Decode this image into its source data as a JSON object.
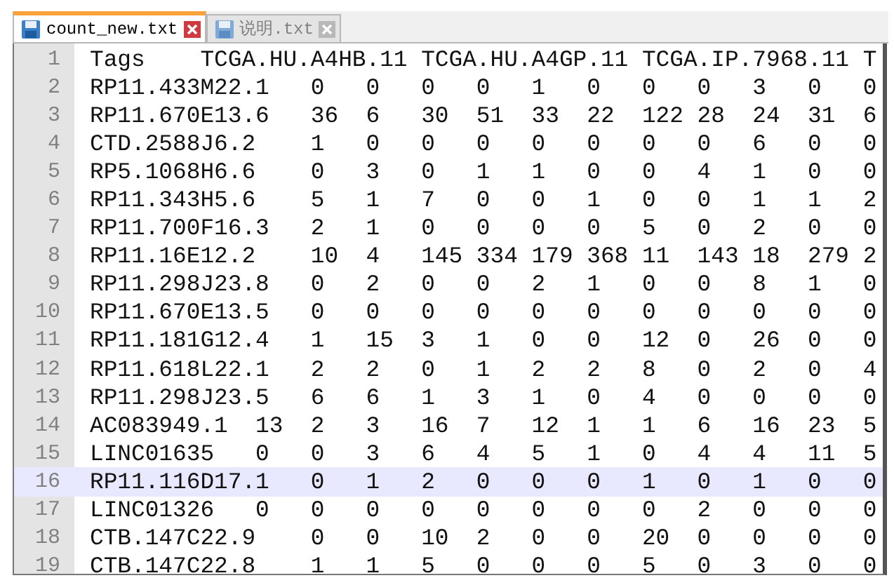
{
  "tabs": [
    {
      "label": "count_new.txt",
      "selected": true
    },
    {
      "label": "说明.txt",
      "selected": false
    }
  ],
  "lines": [
    {
      "number": "1",
      "text": "Tags\tTCGA.HU.A4HB.11\tTCGA.HU.A4GP.11\tTCGA.IP.7968.11\tT",
      "current": false
    },
    {
      "number": "2",
      "text": "RP11.433M22.1\t0\t0\t0\t0\t1\t0\t0\t0\t3\t0\t0",
      "current": false
    },
    {
      "number": "3",
      "text": "RP11.670E13.6\t36\t6\t30\t51\t33\t22\t122\t28\t24\t31\t6",
      "current": false
    },
    {
      "number": "4",
      "text": "CTD.2588J6.2\t1\t0\t0\t0\t0\t0\t0\t0\t6\t0\t0",
      "current": false
    },
    {
      "number": "5",
      "text": "RP5.1068H6.6\t0\t3\t0\t1\t1\t0\t0\t4\t1\t0\t0",
      "current": false
    },
    {
      "number": "6",
      "text": "RP11.343H5.6\t5\t1\t7\t0\t0\t1\t0\t0\t1\t1\t2",
      "current": false
    },
    {
      "number": "7",
      "text": "RP11.700F16.3\t2\t1\t0\t0\t0\t0\t5\t0\t2\t0\t0",
      "current": false
    },
    {
      "number": "8",
      "text": "RP11.16E12.2\t10\t4\t145\t334\t179\t368\t11\t143\t18\t279\t2",
      "current": false
    },
    {
      "number": "9",
      "text": "RP11.298J23.8\t0\t2\t0\t0\t2\t1\t0\t0\t8\t1\t0",
      "current": false
    },
    {
      "number": "10",
      "text": "RP11.670E13.5\t0\t0\t0\t0\t0\t0\t0\t0\t0\t0\t0",
      "current": false
    },
    {
      "number": "11",
      "text": "RP11.181G12.4\t1\t15\t3\t1\t0\t0\t12\t0\t26\t0\t0",
      "current": false
    },
    {
      "number": "12",
      "text": "RP11.618L22.1\t2\t2\t0\t1\t2\t2\t8\t0\t2\t0\t4",
      "current": false
    },
    {
      "number": "13",
      "text": "RP11.298J23.5\t6\t6\t1\t3\t1\t0\t4\t0\t0\t0\t0",
      "current": false
    },
    {
      "number": "14",
      "text": "AC083949.1\t13\t2\t3\t16\t7\t12\t1\t1\t6\t16\t23\t5",
      "current": false
    },
    {
      "number": "15",
      "text": "LINC01635\t0\t0\t3\t6\t4\t5\t1\t0\t4\t4\t11\t5",
      "current": false
    },
    {
      "number": "16",
      "text": "RP11.116D17.1\t0\t1\t2\t0\t0\t0\t1\t0\t1\t0\t0",
      "current": true
    },
    {
      "number": "17",
      "text": "LINC01326\t0\t0\t0\t0\t0\t0\t0\t0\t2\t0\t0\t0",
      "current": false
    },
    {
      "number": "18",
      "text": "CTB.147C22.9\t0\t0\t10\t2\t0\t0\t20\t0\t0\t0\t0",
      "current": false
    },
    {
      "number": "19",
      "text": "CTB.147C22.8\t1\t1\t5\t0\t0\t0\t5\t0\t3\t0\t0",
      "current": false
    }
  ]
}
